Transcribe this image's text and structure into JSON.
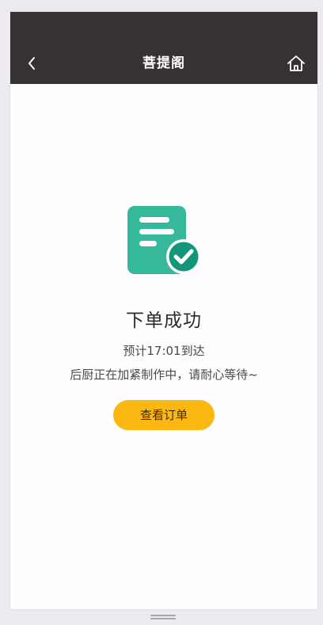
{
  "header": {
    "title": "菩提阁",
    "back_icon": "chevron-left-icon",
    "home_icon": "home-icon"
  },
  "result": {
    "icon": "order-success-icon",
    "title": "下单成功",
    "eta": "预计17:01到达",
    "note": "后厨正在加紧制作中，请耐心等待~",
    "button_label": "查看订单"
  },
  "colors": {
    "header_bg": "#353135",
    "icon_green": "#35b99a",
    "check_green": "#13957a",
    "button_yellow": "#fdb713"
  }
}
